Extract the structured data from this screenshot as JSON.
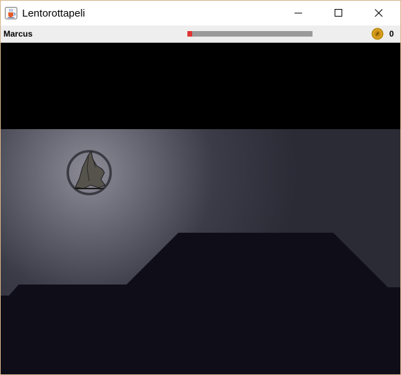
{
  "window": {
    "title": "Lentorottapeli",
    "app_icon": "java-cup-icon",
    "controls": [
      "minimize-icon",
      "maximize-icon",
      "close-icon"
    ]
  },
  "hud": {
    "player_name": "Marcus",
    "health_fraction": 0.04,
    "health_color": "#e03535",
    "coin_icon": "coin-icon",
    "coin_count": "0"
  },
  "game": {
    "sky_color": "#000000",
    "cave_color": "#2b2b36",
    "terrain_color": "#0e0d18",
    "character_icon": "bat-icon"
  }
}
